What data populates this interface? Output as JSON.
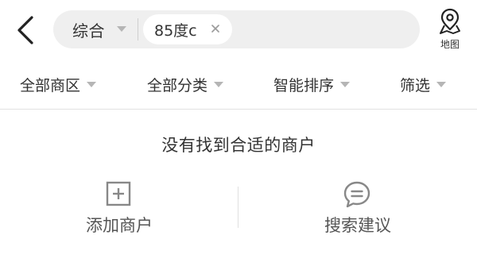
{
  "header": {
    "search_type": "综合",
    "query": "85度c",
    "map_label": "地图"
  },
  "filters": [
    {
      "label": "全部商区"
    },
    {
      "label": "全部分类"
    },
    {
      "label": "智能排序"
    },
    {
      "label": "筛选"
    }
  ],
  "empty_state": {
    "message": "没有找到合适的商户",
    "actions": [
      {
        "label": "添加商户",
        "icon": "add-square-icon"
      },
      {
        "label": "搜索建议",
        "icon": "chat-bubble-icon"
      }
    ]
  },
  "colors": {
    "search_bg": "#efefef",
    "caret": "#b5b5b5",
    "icon_gray": "#888888",
    "text": "#333333"
  }
}
